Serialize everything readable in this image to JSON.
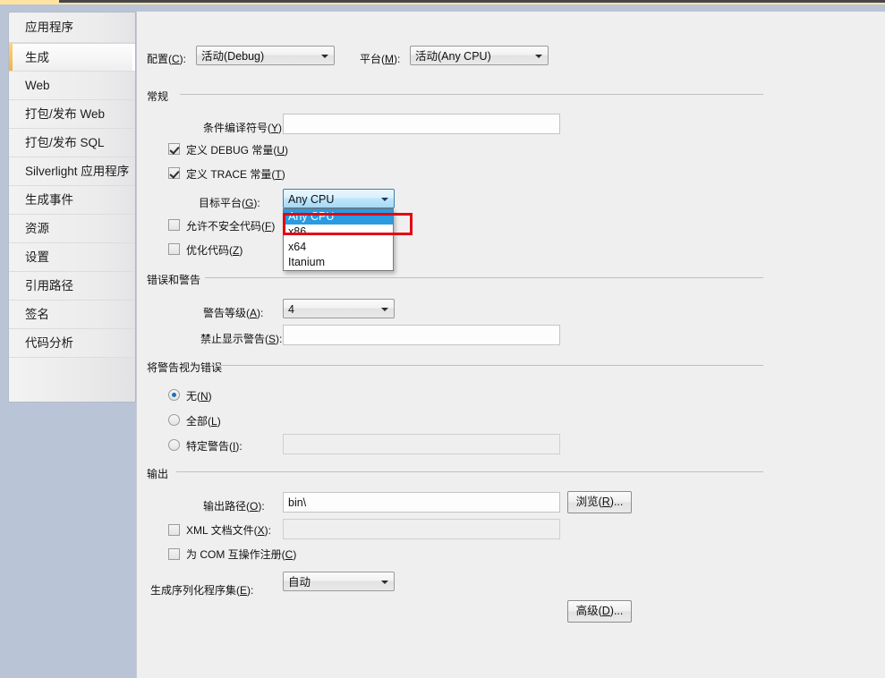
{
  "window": {
    "accent_cream": "#ffe3a0",
    "chrome_blue": "#b9c5d6",
    "panel_bg": "#efefef",
    "annotation_color": "#e30613",
    "selection_blue": "#2a9ae1"
  },
  "sidebar": {
    "items": [
      {
        "label": "应用程序",
        "selected": false
      },
      {
        "label": "生成",
        "selected": true
      },
      {
        "label": "Web",
        "selected": false
      },
      {
        "label": "打包/发布 Web",
        "selected": false
      },
      {
        "label": "打包/发布 SQL",
        "selected": false
      },
      {
        "label": "Silverlight 应用程序",
        "selected": false
      },
      {
        "label": "生成事件",
        "selected": false
      },
      {
        "label": "资源",
        "selected": false
      },
      {
        "label": "设置",
        "selected": false
      },
      {
        "label": "引用路径",
        "selected": false
      },
      {
        "label": "签名",
        "selected": false
      },
      {
        "label": "代码分析",
        "selected": false
      }
    ]
  },
  "toolbar": {
    "configuration_label": "配置(C):",
    "configuration_value": "活动(Debug)",
    "platform_label": "平台(M):",
    "platform_value": "活动(Any CPU)"
  },
  "general": {
    "group_title": "常规",
    "cond_symbols_label": "条件编译符号(Y):",
    "cond_symbols_value": "",
    "define_debug_label": "定义 DEBUG 常量(U)",
    "define_debug_checked": true,
    "define_trace_label": "定义 TRACE 常量(T)",
    "define_trace_checked": true,
    "target_platform_label": "目标平台(G):",
    "target_platform_value": "Any CPU",
    "allow_unsafe_label": "允许不安全代码(F)",
    "allow_unsafe_checked": false,
    "optimize_label": "优化代码(Z)",
    "optimize_checked": false
  },
  "target_platform_dropdown": {
    "open": true,
    "options": [
      "Any CPU",
      "x86",
      "x64",
      "Itanium"
    ],
    "selected_index": 0,
    "annotated_option": "x86"
  },
  "errors_warnings": {
    "group_title": "错误和警告",
    "warning_level_label": "警告等级(A):",
    "warning_level_value": "4",
    "suppress_warnings_label": "禁止显示警告(S):",
    "suppress_warnings_value": ""
  },
  "warnings_as_errors": {
    "group_title": "将警告视为错误",
    "options": [
      {
        "label": "无(N)",
        "checked": true
      },
      {
        "label": "全部(L)",
        "checked": false
      },
      {
        "label": "特定警告(I):",
        "checked": false
      }
    ],
    "specific_warnings_value": ""
  },
  "output": {
    "group_title": "输出",
    "output_path_label": "输出路径(O):",
    "output_path_value": "bin\\",
    "browse_button": "浏览(R)...",
    "xml_doc_label": "XML 文档文件(X):",
    "xml_doc_checked": false,
    "xml_doc_value": "",
    "com_interop_label": "为 COM 互操作注册(C)",
    "com_interop_checked": false,
    "serialization_label": "生成序列化程序集(E):",
    "serialization_value": "自动",
    "advanced_button": "高级(D)..."
  }
}
